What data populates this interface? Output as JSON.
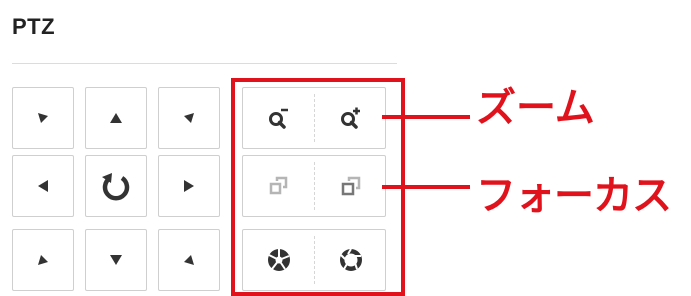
{
  "title": "PTZ",
  "annotations": {
    "zoom": "ズーム",
    "focus": "フォーカス"
  },
  "colors": {
    "annotation": "#e0121c",
    "icon": "#333333",
    "focus_icon": "#b5b5b5",
    "border": "#cfcfcf"
  },
  "icons": {
    "pan_grid": [
      "arrow-down-right",
      "arrow-up",
      "arrow-down-left",
      "arrow-left",
      "reset-rotate",
      "arrow-right",
      "arrow-up-right",
      "arrow-down",
      "arrow-up-left"
    ],
    "zoom": [
      "zoom-out-icon",
      "zoom-in-icon"
    ],
    "focus": [
      "focus-near-icon",
      "focus-far-icon"
    ],
    "iris": [
      "iris-close-icon",
      "iris-open-icon"
    ]
  }
}
